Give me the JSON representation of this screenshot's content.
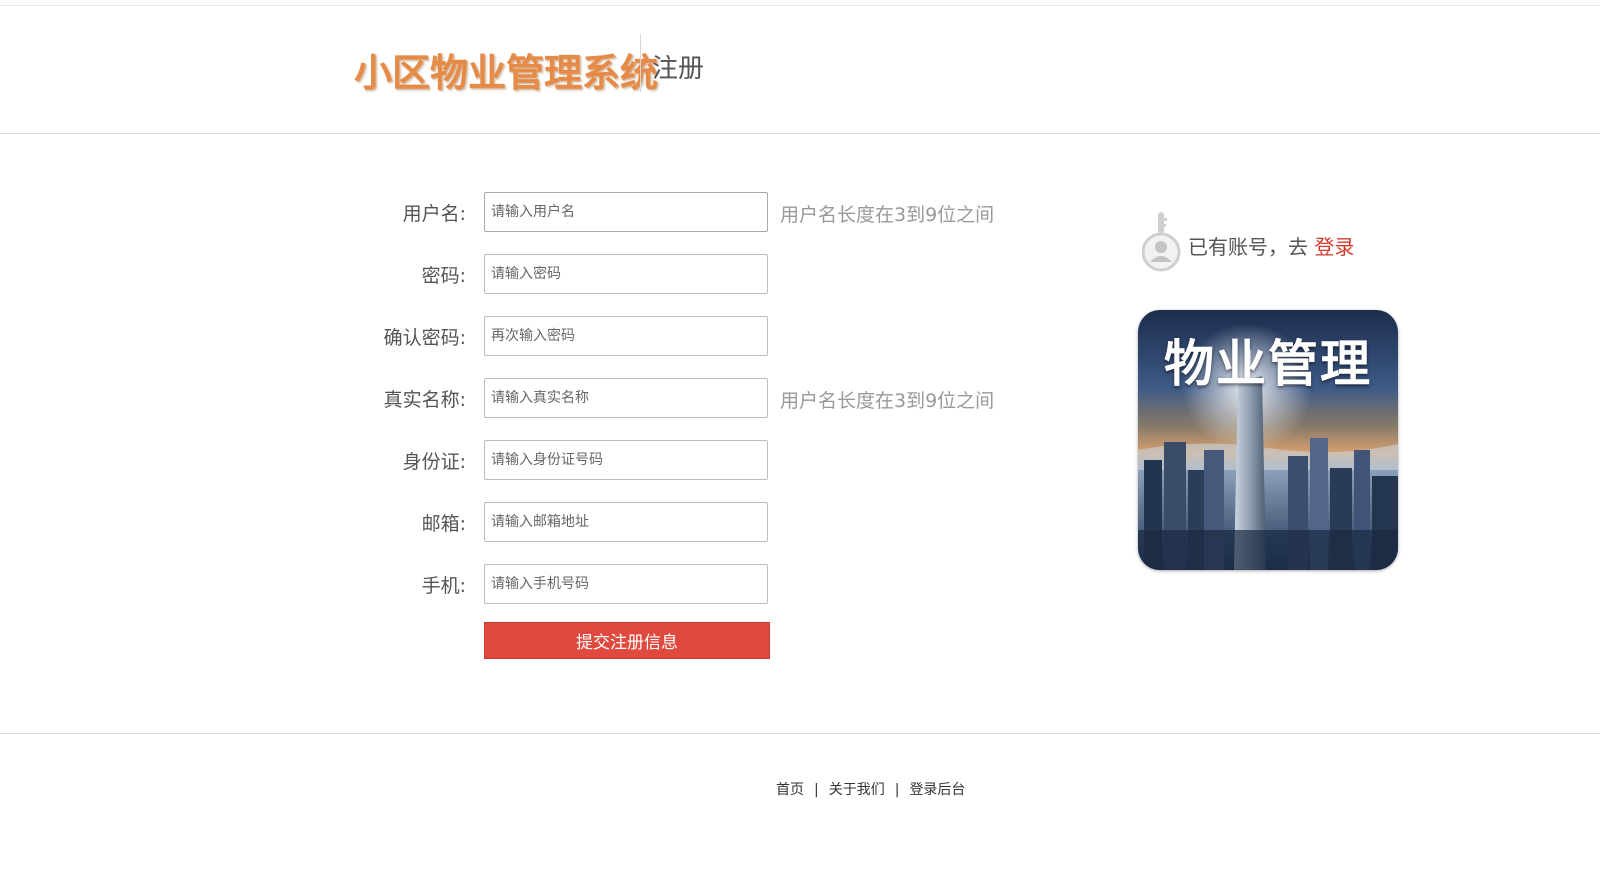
{
  "header": {
    "logo_text": "小区物业管理系统",
    "page_title": "注册"
  },
  "form": {
    "fields": [
      {
        "label": "用户名:",
        "placeholder": "请输入用户名",
        "value": "",
        "hint": "用户名长度在3到9位之间"
      },
      {
        "label": "密码:",
        "placeholder": "请输入密码",
        "value": "",
        "hint": ""
      },
      {
        "label": "确认密码:",
        "placeholder": "再次输入密码",
        "value": "",
        "hint": ""
      },
      {
        "label": "真实名称:",
        "placeholder": "请输入真实名称",
        "value": "",
        "hint": "用户名长度在3到9位之间"
      },
      {
        "label": "身份证:",
        "placeholder": "请输入身份证号码",
        "value": "",
        "hint": ""
      },
      {
        "label": "邮箱:",
        "placeholder": "请输入邮箱地址",
        "value": "",
        "hint": ""
      },
      {
        "label": "手机:",
        "placeholder": "请输入手机号码",
        "value": "",
        "hint": ""
      }
    ],
    "submit_label": "提交注册信息"
  },
  "sidebar": {
    "login_prompt": "已有账号，去 ",
    "login_link": "登录",
    "promo_title": "物业管理",
    "icon": "user-key-icon"
  },
  "footer": {
    "links": [
      "首页",
      "关于我们",
      "登录后台"
    ],
    "separator": "|"
  },
  "colors": {
    "logo": "#e68a48",
    "submit_button": "#e04a3e",
    "login_link": "#d23a2e",
    "hint_text": "#999999"
  }
}
